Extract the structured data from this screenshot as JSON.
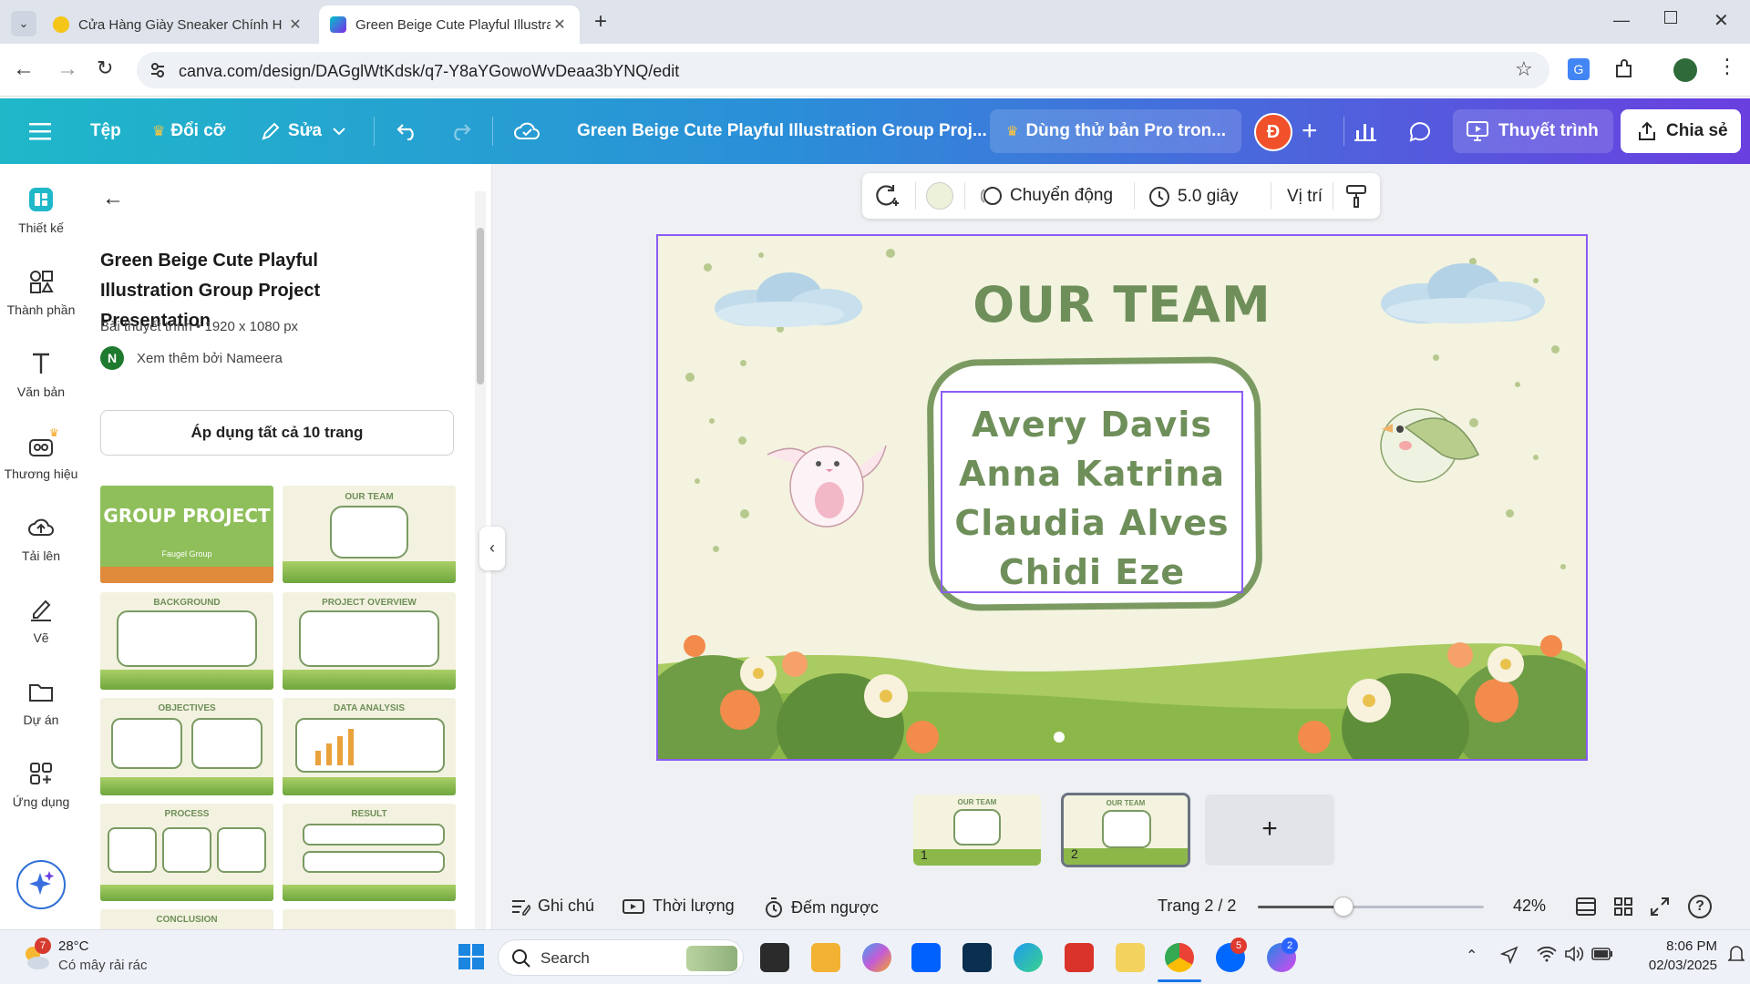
{
  "browser": {
    "tabs": [
      {
        "title": "Cửa Hàng Giày Sneaker Chính H",
        "active": false
      },
      {
        "title": "Green Beige Cute Playful Illustra",
        "active": true
      }
    ],
    "url": "canva.com/design/DAGglWtKdsk/q7-Y8aYGowoWvDeaa3bYNQ/edit"
  },
  "header": {
    "file_label": "Tệp",
    "resize_label": "Đổi cỡ",
    "edit_label": "Sửa",
    "design_title": "Green Beige Cute Playful Illustration Group Proj...",
    "pro_trial_label": "Dùng thử bản Pro tron...",
    "avatar_letter": "Đ",
    "present_label": "Thuyết trình",
    "share_label": "Chia sẻ"
  },
  "rail": {
    "items": [
      {
        "label": "Thiết kế",
        "icon": "design-icon"
      },
      {
        "label": "Thành phần",
        "icon": "elements-icon"
      },
      {
        "label": "Văn bản",
        "icon": "text-icon"
      },
      {
        "label": "Thương hiệu",
        "icon": "brand-icon"
      },
      {
        "label": "Tải lên",
        "icon": "upload-icon"
      },
      {
        "label": "Vẽ",
        "icon": "draw-icon"
      },
      {
        "label": "Dự án",
        "icon": "folder-icon"
      },
      {
        "label": "Ứng dụng",
        "icon": "apps-icon"
      }
    ]
  },
  "panel": {
    "title": "Green Beige Cute Playful Illustration Group Project Presentation",
    "meta": "Bài thuyết trình • 1920 x 1080 px",
    "author_initial": "N",
    "author": "Xem thêm bởi Nameera",
    "apply_all_label": "Áp dụng tất cả 10 trang",
    "templates": [
      {
        "title": "GROUP PROJECT",
        "subtitle": "Faugel Group"
      },
      {
        "title": "OUR TEAM",
        "subtitle": ""
      },
      {
        "title": "BACKGROUND",
        "subtitle": ""
      },
      {
        "title": "PROJECT OVERVIEW",
        "subtitle": ""
      },
      {
        "title": "OBJECTIVES",
        "subtitle": ""
      },
      {
        "title": "DATA ANALYSIS",
        "subtitle": ""
      },
      {
        "title": "PROCESS",
        "subtitle": ""
      },
      {
        "title": "RESULT",
        "subtitle": ""
      },
      {
        "title": "CONCLUSION",
        "subtitle": ""
      }
    ]
  },
  "toolbar": {
    "animation_label": "Chuyển động",
    "duration_label": "5.0 giây",
    "position_label": "Vị trí",
    "bg_color": "#eef1d9"
  },
  "slide": {
    "title": "OUR TEAM",
    "names": [
      "Avery Davis",
      "Anna Katrina",
      "Claudia Alves",
      "Chidi Eze"
    ],
    "title_color": "#6f8f5a"
  },
  "pages": [
    {
      "number": "1",
      "selected": false
    },
    {
      "number": "2",
      "selected": true
    }
  ],
  "bottom": {
    "notes_label": "Ghi chú",
    "duration_label": "Thời lượng",
    "timer_label": "Đếm ngược",
    "page_indicator": "Trang 2 / 2",
    "zoom": "42%",
    "zoom_fraction": 0.38
  },
  "taskbar": {
    "weather_temp": "28°C",
    "weather_desc": "Có mây rải rác",
    "weather_badge": "7",
    "search_placeholder": "Search",
    "time": "8:06 PM",
    "date": "02/03/2025",
    "zalo_badge": "5",
    "messenger_badge": "2"
  },
  "colors": {
    "accent_purple": "#8b5cf6",
    "header_start": "#1fb8c9",
    "header_end": "#6a3fe0",
    "slide_green": "#6f8f5a"
  }
}
